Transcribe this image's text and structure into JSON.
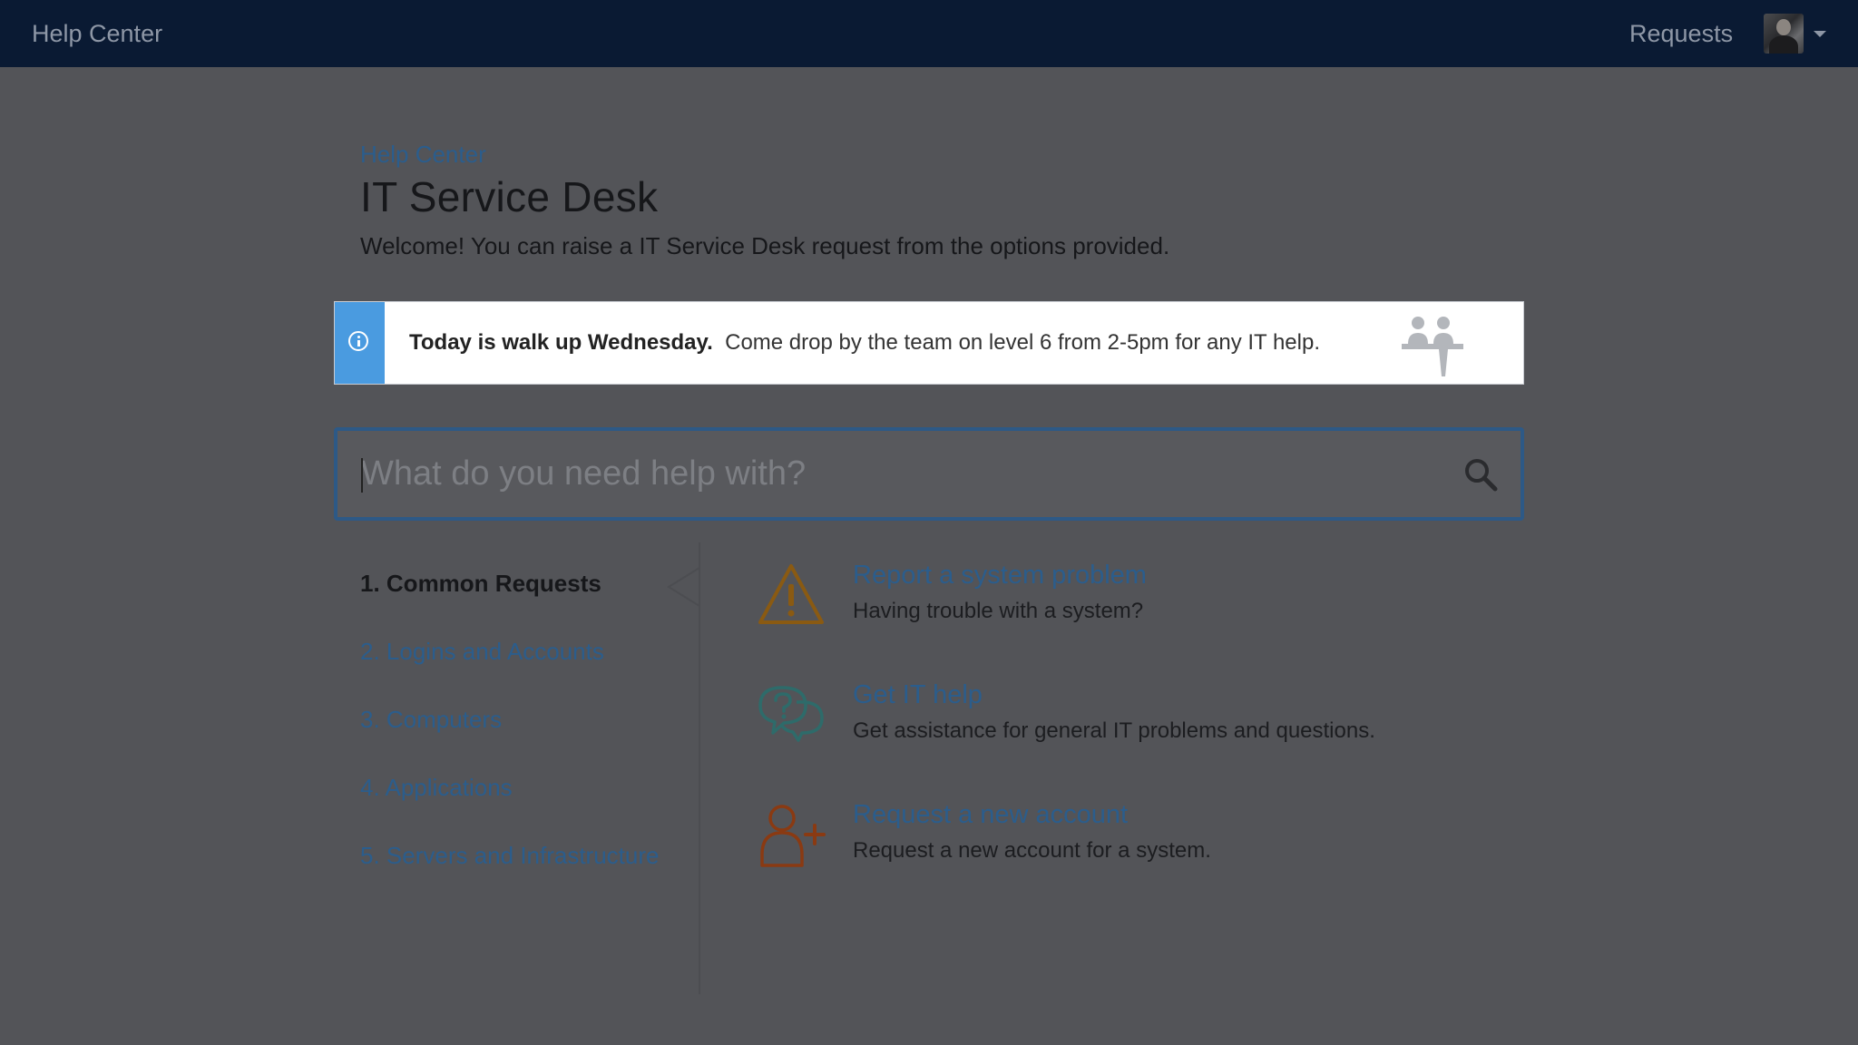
{
  "topbar": {
    "title": "Help Center",
    "requests_label": "Requests"
  },
  "breadcrumb": "Help Center",
  "page_title": "IT Service Desk",
  "welcome_text": "Welcome! You can raise a IT Service Desk request from the options provided.",
  "announcement": {
    "headline": "Today is walk up Wednesday.",
    "message": "Come drop by the team on level 6 from 2-5pm for any IT help."
  },
  "search": {
    "placeholder": "What do you need help with?",
    "value": ""
  },
  "categories": [
    {
      "label": "1. Common Requests",
      "active": true
    },
    {
      "label": "2. Logins and Accounts",
      "active": false
    },
    {
      "label": "3. Computers",
      "active": false
    },
    {
      "label": "4. Applications",
      "active": false
    },
    {
      "label": "5. Servers and Infrastructure",
      "active": false
    }
  ],
  "request_types": [
    {
      "title": "Report a system problem",
      "description": "Having trouble with a system?",
      "icon": "warning-icon"
    },
    {
      "title": "Get IT help",
      "description": "Get assistance for general IT problems and questions.",
      "icon": "question-chat-icon"
    },
    {
      "title": "Request a new account",
      "description": "Request a new account for a system.",
      "icon": "add-user-icon"
    }
  ],
  "colors": {
    "topbar": "#0a1a33",
    "link": "#2b5d8c",
    "info_stripe": "#4a9be0",
    "search_border": "#2d5986",
    "overlay_background": "#535458"
  }
}
